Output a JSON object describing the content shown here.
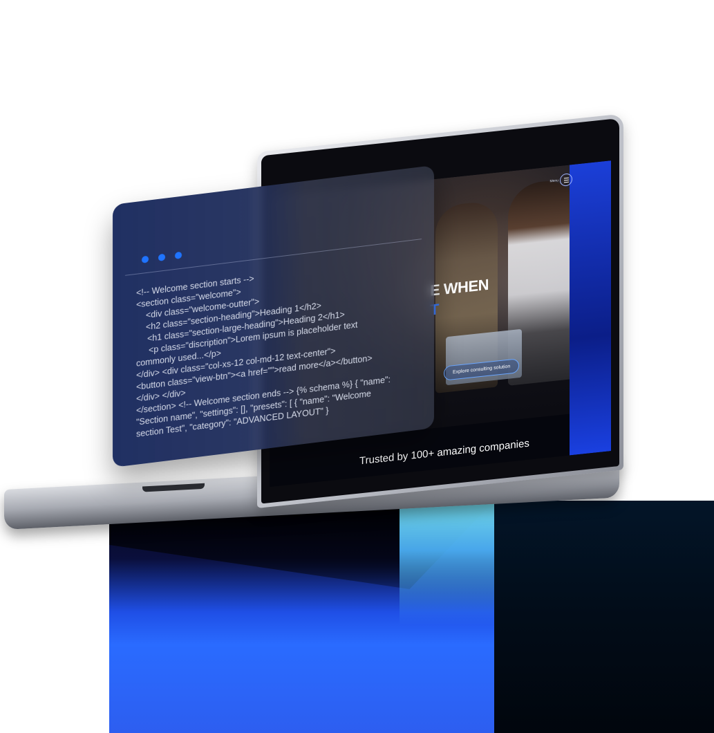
{
  "screen": {
    "menu_label": "Menu",
    "headline": "E WHEN",
    "headline_accent": "T",
    "cta_label": "Explore consulting solution",
    "trusted_text": "Trusted by 100+ amazing companies"
  },
  "code_panel": {
    "dot_color": "#1f74ff",
    "lines": [
      "<!-- Welcome section starts -->",
      "<section class=\"welcome\">",
      "<div class=\"welcome-outter\">",
      "<h2 class=\"section-heading\">Heading 1</h2>",
      "<h1 class=\"section-large-heading\">Heading 2</h1>",
      "<p class=\"discription\">Lorem ipsum is placeholder text",
      "commonly used...</p>",
      "</div> <div class=\"col-xs-12 col-md-12 text-center\">",
      "<button class=\"view-btn\"><a href=\"\">read more</a></button>",
      "</div> </div>",
      "</section> <!-- Welcome section ends --> {% schema %} { \"name\":",
      "\"Section name\", \"settings\": [], \"presets\": [ { \"name\": \"Welcome",
      "section Test\", \"category\": \"ADVANCED LAYOUT\" }"
    ]
  },
  "colors": {
    "accent_blue": "#2a6bff",
    "pedestal_glow": "#7ff0ff",
    "pedestal_side": "#020c18"
  }
}
